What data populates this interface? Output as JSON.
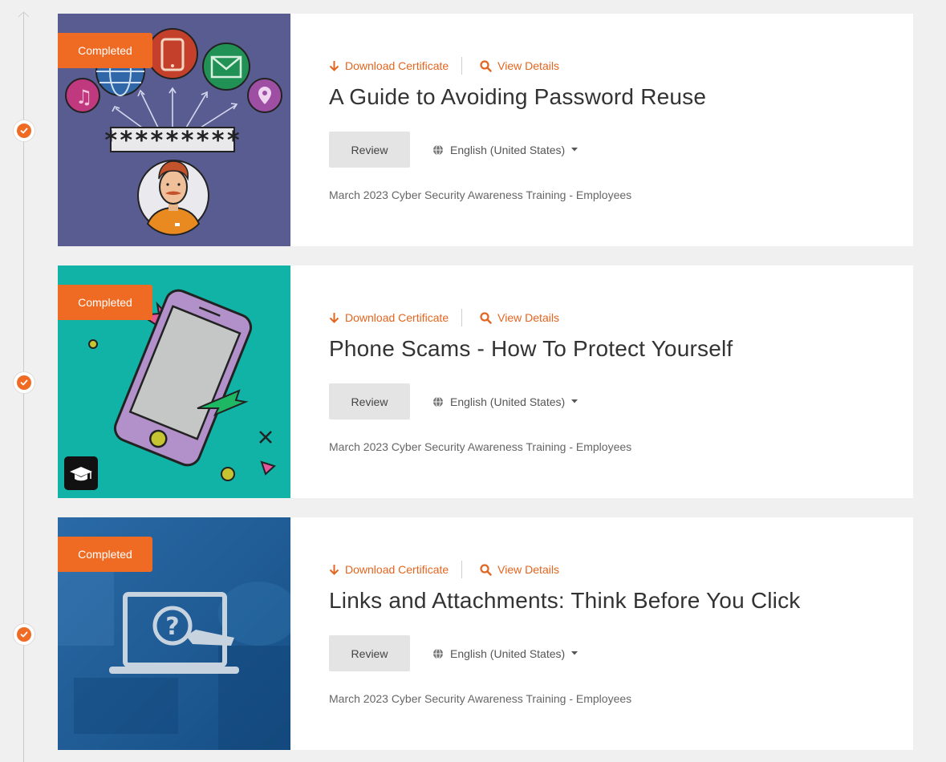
{
  "status_color": "#ef6b24",
  "courses": [
    {
      "badge": "Completed",
      "download_label": "Download Certificate",
      "details_label": "View Details",
      "title": "A Guide to Avoiding Password Reuse",
      "review_label": "Review",
      "language": "English (United States)",
      "campaign": "March 2023 Cyber Security Awareness Training - Employees",
      "password_mask": "*********",
      "thumb_bg": "#585c91"
    },
    {
      "badge": "Completed",
      "download_label": "Download Certificate",
      "details_label": "View Details",
      "title": "Phone Scams - How To Protect Yourself",
      "review_label": "Review",
      "language": "English (United States)",
      "campaign": "March 2023 Cyber Security Awareness Training - Employees",
      "thumb_bg": "#10b3a5"
    },
    {
      "badge": "Completed",
      "download_label": "Download Certificate",
      "details_label": "View Details",
      "title": "Links and Attachments: Think Before You Click",
      "review_label": "Review",
      "language": "English (United States)",
      "campaign": "March 2023 Cyber Security Awareness Training - Employees",
      "thumb_bg": "#1d5f99"
    }
  ]
}
